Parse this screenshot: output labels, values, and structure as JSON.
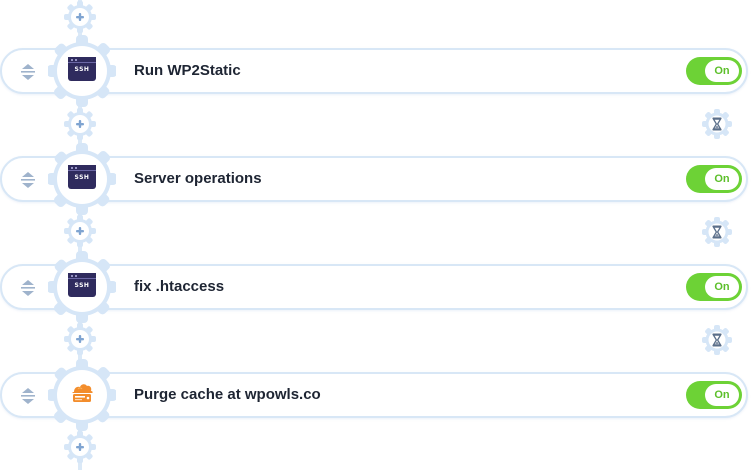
{
  "steps": [
    {
      "title": "Run WP2Static",
      "icon": "ssh-terminal-icon",
      "icon_text": "SSH",
      "toggle_label": "On"
    },
    {
      "title": "Server operations",
      "icon": "ssh-terminal-icon",
      "icon_text": "SSH",
      "toggle_label": "On"
    },
    {
      "title": "fix .htaccess",
      "icon": "ssh-terminal-icon",
      "icon_text": "SSH",
      "toggle_label": "On"
    },
    {
      "title": "Purge cache at wpowls.co",
      "icon": "cloudflare-cache-icon",
      "icon_text": "",
      "toggle_label": "On"
    }
  ],
  "colors": {
    "connector": "#dbe9f7",
    "toggle_on": "#6dd236",
    "ssh_icon": "#2f2b5e",
    "gear": "#d6e6f7",
    "plus": "#7fa4d1",
    "hourglass": "#5b6f8a"
  }
}
